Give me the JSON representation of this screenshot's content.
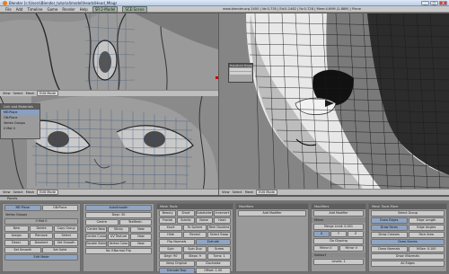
{
  "window": {
    "title": "Blender [c:\\Users\\Blender_tutorial\\model\\heads\\Head_Mlaga03.blend]",
    "buttons": [
      "_",
      "□",
      "X"
    ]
  },
  "menubar": {
    "items": [
      "File",
      "Add",
      "Timeline",
      "Game",
      "Render",
      "Help"
    ],
    "screen": "SR:2-Model",
    "scene": "SCE:Scene",
    "status": "www.blender.org 2450 | Ve:0-735 | Ed:0-1462 | Fa:0-728 | Mem:4.69M (2.88M) | Plane"
  },
  "viewports": {
    "top_left_header": [
      "View",
      "Select",
      "Mesh",
      "Edit Mode"
    ],
    "bottom_left_header": [
      "View",
      "Select",
      "Mesh",
      "Edit Mode"
    ],
    "right_header": [
      "View",
      "Select",
      "Mesh",
      "Edit Mode"
    ],
    "popup_title": "Transform Properties"
  },
  "left_panels": {
    "link_title": "Link and Materials",
    "me_label": "ME:Plane",
    "ob_label": "OB:Plane",
    "vertex_groups": "Vertex Groups",
    "mat_label": "0 Mat 0",
    "buttons_row1": [
      "New",
      "Delete",
      "Copy Group"
    ],
    "buttons_row2": [
      "Assign",
      "Remove",
      "Select"
    ],
    "buttons_row3": [
      "Desel.",
      "Deselect",
      "Set Smooth"
    ],
    "auto_smooth": "AutoSmooth",
    "degr": "Degr: 30",
    "centre": "Centre",
    "centre_new": "Centre New",
    "centre_cursor": "Centre Cursor",
    "double_sided": "Double Sided",
    "no_v_normal_flip": "No V.Normal Flip",
    "texmesh": "TexMesh:",
    "sticky": "Sticky",
    "uv_texture": "UV Texture",
    "vertex_color": "Vertex Color",
    "new1": "New",
    "new2": "New",
    "new3": "New",
    "set_smooth": "Set Smooth",
    "set_solid": "Set Solid",
    "edit_tool": "Edit Mode"
  },
  "mesh_tools": {
    "title": "Mesh Tools",
    "row1": [
      "Beauty",
      "Short",
      "Subdivide",
      "Innervert"
    ],
    "row2": [
      "Fractal",
      "Subdiv",
      "Noise",
      "Hash"
    ],
    "row3": [
      "Xsort",
      "To Sphere",
      "Rem Doubles"
    ],
    "row4": [
      "Hide",
      "Reveal",
      "Select Swap"
    ],
    "row5": [
      "Flip Normals",
      "Extrude"
    ],
    "row6": [
      "Spin",
      "Spin Dup",
      "Screw"
    ],
    "row7": [
      "Degr: 90",
      "Steps: 9",
      "Turns: 1"
    ],
    "row8": [
      "Keep Original",
      "Clockwise"
    ],
    "row9": [
      "Extrude Dup",
      "Offset: 1.00"
    ],
    "row10": [
      "Join Triangles",
      "Threshold 0.800"
    ],
    "row11": [
      "Delimit UVs",
      "Delimit Vcol",
      "Delimit Sharp"
    ]
  },
  "modifiers": {
    "title": "Modifiers",
    "add": "Add Modifier",
    "mirror_label": "Mirror",
    "subsurf_label": "Subsurf",
    "merge_limit": "Merge Limit: 0.001",
    "axis": [
      "X",
      "Y",
      "Z"
    ],
    "do_clipping": "Do Clipping",
    "mirror_u": "Mirror U",
    "mirror_v": "Mirror V",
    "levels": "Levels: 1",
    "render_levels": "Render Levels: 2",
    "optimal_draw": "Optimal Draw"
  },
  "mesh_tools_more": {
    "title": "Mesh Tools More",
    "select_group": "Select Group",
    "draw_edges": "Draw Edges",
    "draw_faces": "Draw Faces",
    "draw_creases": "Draw Creases",
    "draw_seams": "Draw Seams",
    "draw_normals": "Draw Normals",
    "draw_vnormals": "Draw VNormals",
    "edge_length": "Edge Length",
    "edge_angles": "Edge Angles",
    "face_area": "Face Area",
    "nsize": "NSize: 0.100",
    "all_edges": "All Edges"
  }
}
